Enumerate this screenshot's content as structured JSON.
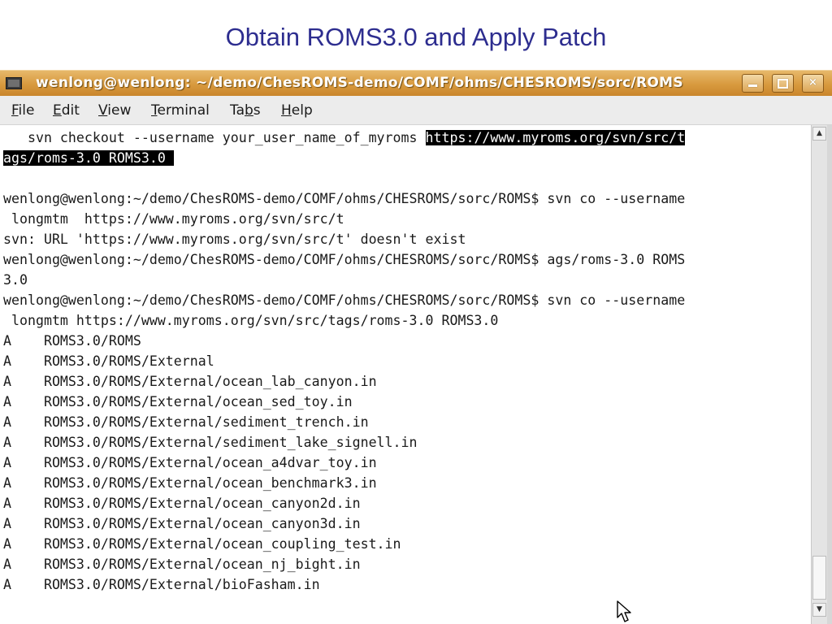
{
  "slide": {
    "title": "Obtain ROMS3.0 and Apply Patch"
  },
  "window": {
    "title": "wenlong@wenlong: ~/demo/ChesROMS-demo/COMF/ohms/CHESROMS/sorc/ROMS",
    "icon": "terminal-icon",
    "buttons": {
      "minimize": "minimize-icon",
      "maximize": "maximize-icon",
      "close": "×"
    }
  },
  "menu": {
    "items": [
      {
        "key": "F",
        "rest": "ile"
      },
      {
        "key": "E",
        "rest": "dit"
      },
      {
        "key": "V",
        "rest": "iew"
      },
      {
        "key": "T",
        "rest": "erminal"
      },
      {
        "pre": "Ta",
        "key": "b",
        "rest": "s"
      },
      {
        "key": "H",
        "rest": "elp"
      }
    ]
  },
  "terminal": {
    "line0_plain": "   svn checkout --username your_user_name_of_myroms ",
    "line0_selected": "https://www.myroms.org/svn/src/t",
    "line1_selected": "ags/roms-3.0 ROMS3.0 ",
    "lines": [
      "",
      "wenlong@wenlong:~/demo/ChesROMS-demo/COMF/ohms/CHESROMS/sorc/ROMS$ svn co --username",
      " longmtm  https://www.myroms.org/svn/src/t",
      "svn: URL 'https://www.myroms.org/svn/src/t' doesn't exist",
      "wenlong@wenlong:~/demo/ChesROMS-demo/COMF/ohms/CHESROMS/sorc/ROMS$ ags/roms-3.0 ROMS",
      "3.0",
      "wenlong@wenlong:~/demo/ChesROMS-demo/COMF/ohms/CHESROMS/sorc/ROMS$ svn co --username",
      " longmtm https://www.myroms.org/svn/src/tags/roms-3.0 ROMS3.0",
      "A    ROMS3.0/ROMS",
      "A    ROMS3.0/ROMS/External",
      "A    ROMS3.0/ROMS/External/ocean_lab_canyon.in",
      "A    ROMS3.0/ROMS/External/ocean_sed_toy.in",
      "A    ROMS3.0/ROMS/External/sediment_trench.in",
      "A    ROMS3.0/ROMS/External/sediment_lake_signell.in",
      "A    ROMS3.0/ROMS/External/ocean_a4dvar_toy.in",
      "A    ROMS3.0/ROMS/External/ocean_benchmark3.in",
      "A    ROMS3.0/ROMS/External/ocean_canyon2d.in",
      "A    ROMS3.0/ROMS/External/ocean_canyon3d.in",
      "A    ROMS3.0/ROMS/External/ocean_coupling_test.in",
      "A    ROMS3.0/ROMS/External/ocean_nj_bight.in",
      "A    ROMS3.0/ROMS/External/bioFasham.in"
    ]
  },
  "scrollbar": {
    "up": "▲",
    "down": "▼",
    "position": 0.95
  }
}
